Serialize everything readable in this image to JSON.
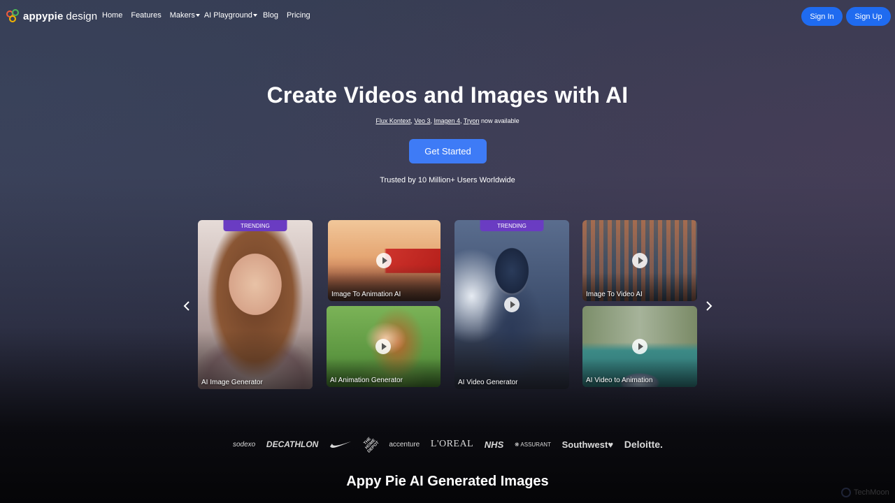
{
  "nav": {
    "logo_bold": "appypie",
    "logo_rest": "design",
    "links": [
      "Home",
      "Features",
      "Makers",
      "AI Playground",
      "Blog",
      "Pricing"
    ],
    "sign_in": "Sign In",
    "sign_up": "Sign Up"
  },
  "hero": {
    "title": "Create Videos and Images with AI",
    "models": [
      "Flux Kontext",
      "Veo 3",
      "Imagen 4",
      "Tryon"
    ],
    "available_text": "now available",
    "cta": "Get Started",
    "trusted": "Trusted by 10 Million+ Users Worldwide"
  },
  "carousel": {
    "badge": "TRENDING",
    "cards": [
      {
        "label": "AI Image Generator",
        "trending": true,
        "video": false
      },
      {
        "label": "Image To Animation AI",
        "trending": false,
        "video": true
      },
      {
        "label": "AI Animation Generator",
        "trending": false,
        "video": true
      },
      {
        "label": "AI Video Generator",
        "trending": true,
        "video": true
      },
      {
        "label": "Image To Video AI",
        "trending": false,
        "video": true
      },
      {
        "label": "AI Video to Animation",
        "trending": false,
        "video": true
      }
    ]
  },
  "clients": {
    "sodexo": "sodexo",
    "decathlon": "DECATHLON",
    "homedepot": "THE HOME DEPOT",
    "accenture": "accenture",
    "loreal": "L'OREAL",
    "nhs": "NHS",
    "assurant": "ASSURANT",
    "southwest": "Southwest",
    "deloitte": "Deloitte."
  },
  "section": {
    "title": "Appy Pie AI Generated Images"
  },
  "watermark": "TechMoon",
  "colors": {
    "primary_button": "#1f6bf0",
    "cta": "#3e7bf6",
    "trending_badge": "#6a3cc2"
  }
}
